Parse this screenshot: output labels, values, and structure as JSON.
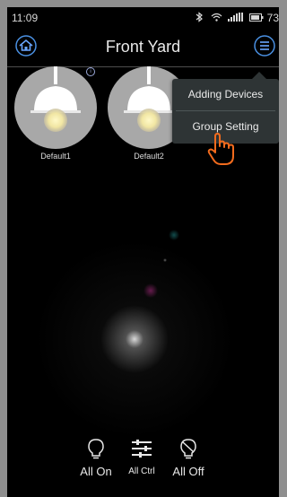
{
  "status_bar": {
    "time": "11:09",
    "battery": "73"
  },
  "header": {
    "title": "Front Yard"
  },
  "devices": [
    {
      "name": "Default1"
    },
    {
      "name": "Default2"
    }
  ],
  "dropdown_menu": {
    "items": [
      {
        "label": "Adding Devices"
      },
      {
        "label": "Group Setting"
      }
    ]
  },
  "bottom_bar": {
    "all_on_label": "All On",
    "all_ctrl_label": "All Ctrl",
    "all_off_label": "All Off"
  },
  "colors": {
    "background": "#000000",
    "menu": "#2e3435",
    "accent": "#f26b1d",
    "device_circle": "#a8a8a8"
  }
}
